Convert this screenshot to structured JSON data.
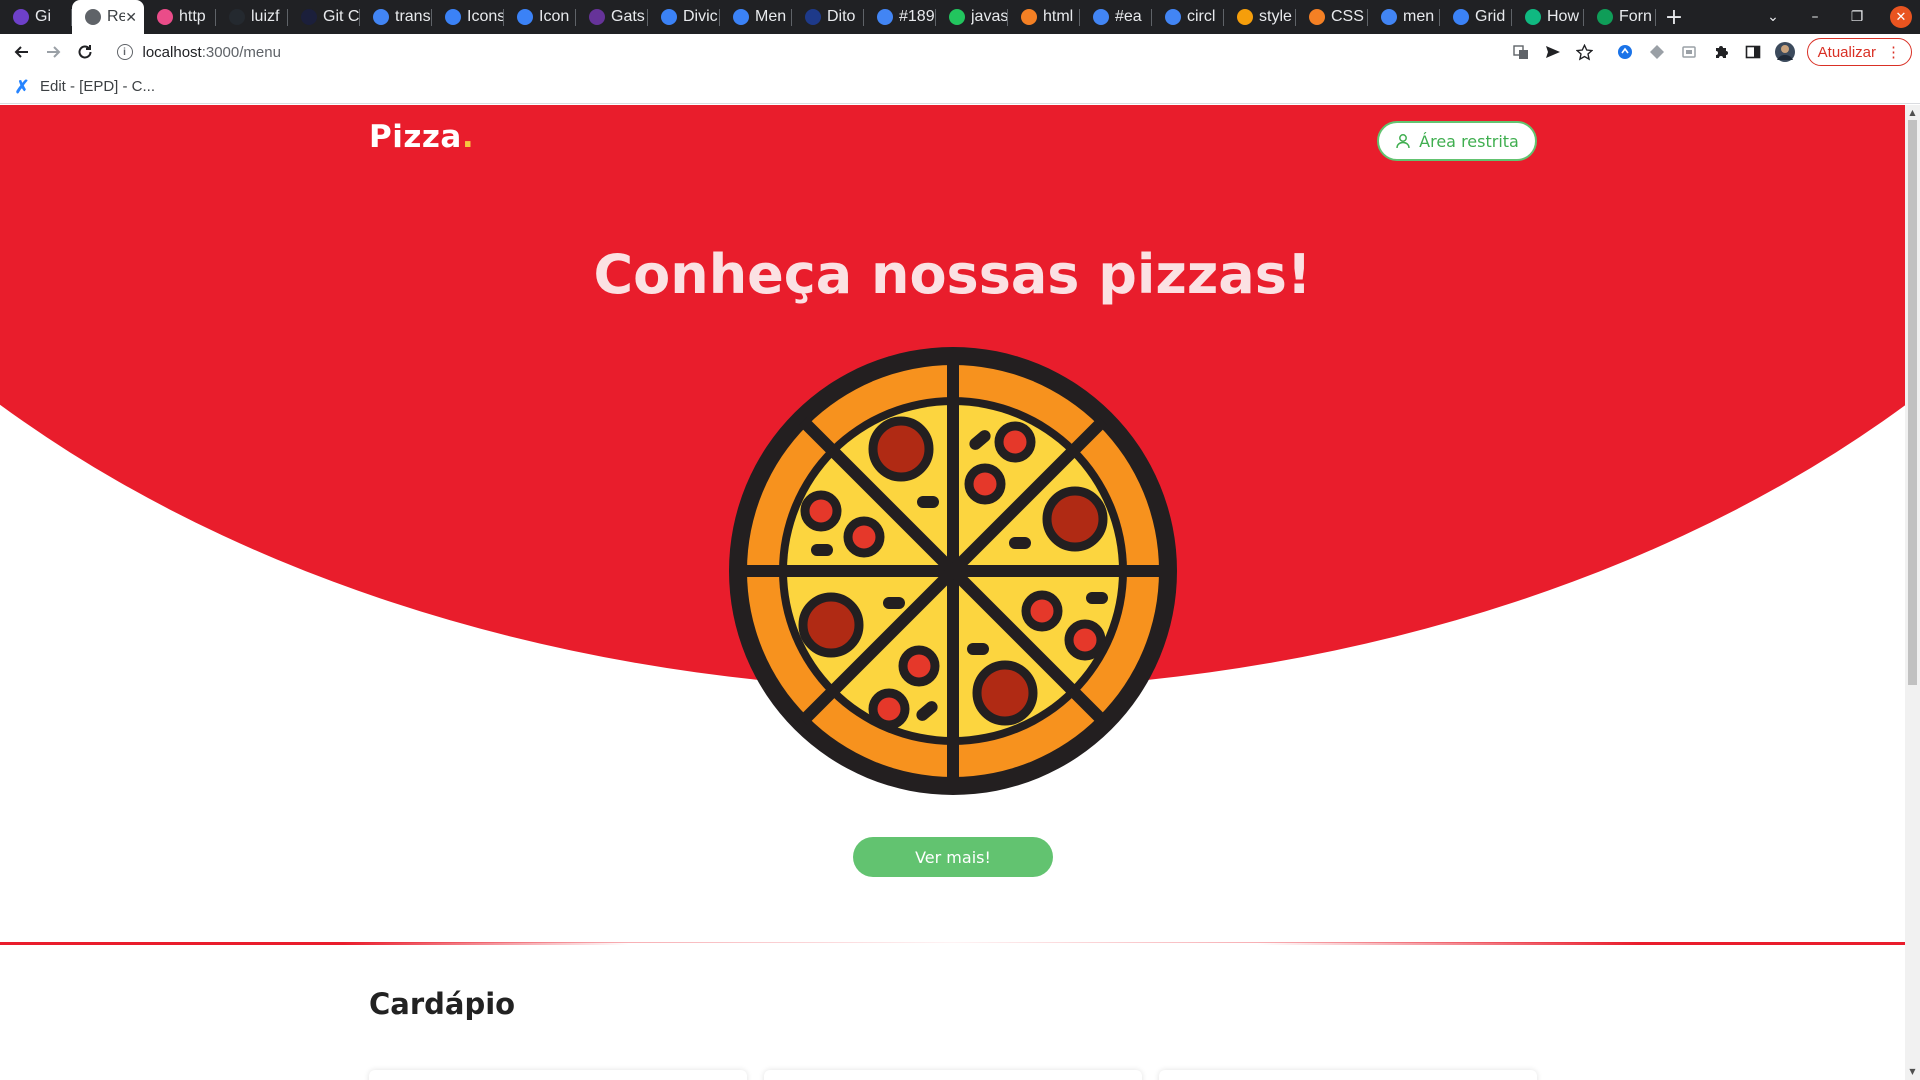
{
  "browser": {
    "tabs": [
      {
        "label": "Gi",
        "favicon": "github-icon",
        "color": "#6e40c9"
      },
      {
        "label": "Re",
        "favicon": "loading-icon",
        "color": "#5f6368",
        "active": true
      },
      {
        "label": "http",
        "favicon": "dribbble-icon",
        "color": "#ea4c89"
      },
      {
        "label": "luizf",
        "favicon": "github-icon",
        "color": "#24292f"
      },
      {
        "label": "Git C",
        "favicon": "vercel-icon",
        "color": "#1b1f3b"
      },
      {
        "label": "trans",
        "favicon": "google-icon",
        "color": "#4285f4"
      },
      {
        "label": "Icons",
        "favicon": "diamond-icon",
        "color": "#3b82f6"
      },
      {
        "label": "Icon",
        "favicon": "diamond-icon",
        "color": "#3b82f6"
      },
      {
        "label": "Gats",
        "favicon": "gatsby-icon",
        "color": "#663399"
      },
      {
        "label": "Divic",
        "favicon": "diamond-icon",
        "color": "#3b82f6"
      },
      {
        "label": "Men",
        "favicon": "diamond-icon",
        "color": "#3b82f6"
      },
      {
        "label": "Dito",
        "favicon": "dito-icon",
        "color": "#1e3a8a"
      },
      {
        "label": "#189",
        "favicon": "google-icon",
        "color": "#4285f4"
      },
      {
        "label": "javas",
        "favicon": "spark-icon",
        "color": "#22c55e"
      },
      {
        "label": "html",
        "favicon": "stackoverflow-icon",
        "color": "#f48024"
      },
      {
        "label": "#ea",
        "favicon": "google-icon",
        "color": "#4285f4"
      },
      {
        "label": "circl",
        "favicon": "google-icon",
        "color": "#4285f4"
      },
      {
        "label": "style",
        "favicon": "spark-icon",
        "color": "#f59e0b"
      },
      {
        "label": "CSS",
        "favicon": "stackoverflow-icon",
        "color": "#f48024"
      },
      {
        "label": "men",
        "favicon": "google-icon",
        "color": "#4285f4"
      },
      {
        "label": "Grid",
        "favicon": "diamond-icon",
        "color": "#3b82f6"
      },
      {
        "label": "How",
        "favicon": "infinity-icon",
        "color": "#10b981"
      },
      {
        "label": "Forn",
        "favicon": "sheet-icon",
        "color": "#0f9d58"
      }
    ],
    "url_host": "localhost",
    "url_path": ":3000/menu",
    "update_label": "Atualizar",
    "bookmark_label": "Edit - [EPD] - C..."
  },
  "page": {
    "logo_text": "Pizza",
    "logo_dot": ".",
    "restricted_label": "Área restrita",
    "hero_title": "Conheça nossas pizzas!",
    "cta_label": "Ver mais!",
    "menu_title": "Cardápio",
    "colors": {
      "brand_red": "#e91d2c",
      "accent_green": "#62c370",
      "logo_dot": "#f6c63f"
    }
  }
}
